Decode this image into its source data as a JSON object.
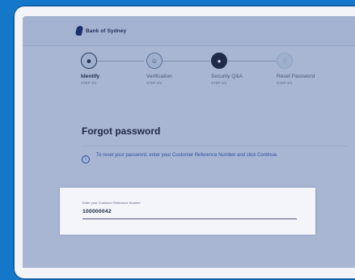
{
  "brand": {
    "name": "Bank of Sydney"
  },
  "steps": [
    {
      "label": "Identify",
      "sub": "STEP 1/4",
      "icon": "user-id-icon"
    },
    {
      "label": "Verification",
      "sub": "STEP 2/4",
      "icon": "user-verification-icon"
    },
    {
      "label": "Security Q&A",
      "sub": "STEP 3/4",
      "icon": "shield-icon"
    },
    {
      "label": "Reset Password",
      "sub": "STEP 4/4",
      "icon": "key-icon"
    }
  ],
  "page": {
    "title": "Forgot password",
    "info": "To reset your password, enter your Customer Reference Number and click Continue."
  },
  "form": {
    "label": "Enter your Customer Reference Number",
    "value": "100000042"
  }
}
